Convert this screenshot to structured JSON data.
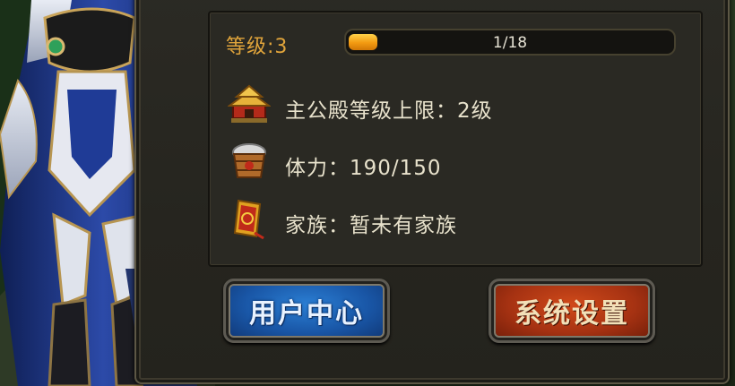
{
  "profile": {
    "level_label": "等级:3",
    "exp_text": "1/18",
    "exp_progress": 0.056,
    "rows": [
      {
        "icon": "palace-icon",
        "text": "主公殿等级上限：2级"
      },
      {
        "icon": "rice-bucket-icon",
        "text": "体力：190/150"
      },
      {
        "icon": "family-token-icon",
        "text": "家族：暂未有家族"
      }
    ]
  },
  "buttons": {
    "user_center": "用户中心",
    "system_settings": "系统设置"
  },
  "colors": {
    "accent_orange": "#e0a43b",
    "progress_fill": "#f39a11",
    "button_blue": "#1956a6",
    "button_red": "#a63212"
  }
}
